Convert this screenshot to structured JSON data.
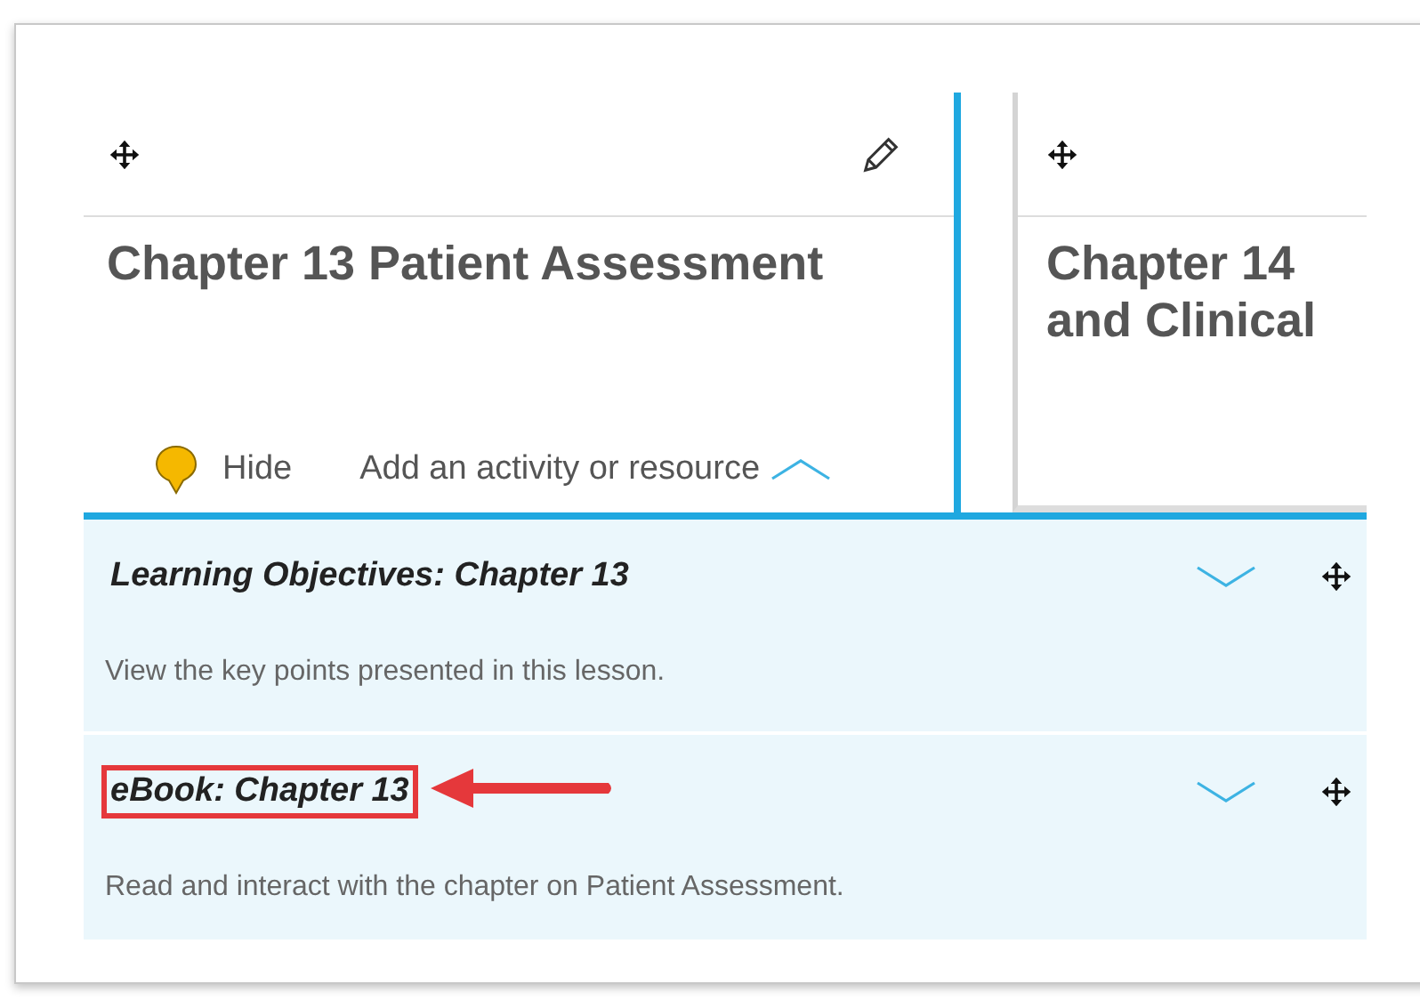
{
  "lessons": [
    {
      "title_lines": [
        "Chapter 13 Patient Assessment"
      ],
      "editable": true,
      "hide_label": "Hide",
      "add_label": "Add an activity or resource",
      "selected": true
    },
    {
      "title_lines": [
        "Chapter 14",
        "and Clinical"
      ],
      "editable": false,
      "selected": false
    }
  ],
  "items": [
    {
      "title": "Learning Objectives: Chapter 13",
      "description": "View the key points presented in this lesson.",
      "highlighted": false
    },
    {
      "title": "eBook: Chapter 13",
      "description": "Read and interact with the chapter on Patient Assessment.",
      "highlighted": true
    }
  ]
}
